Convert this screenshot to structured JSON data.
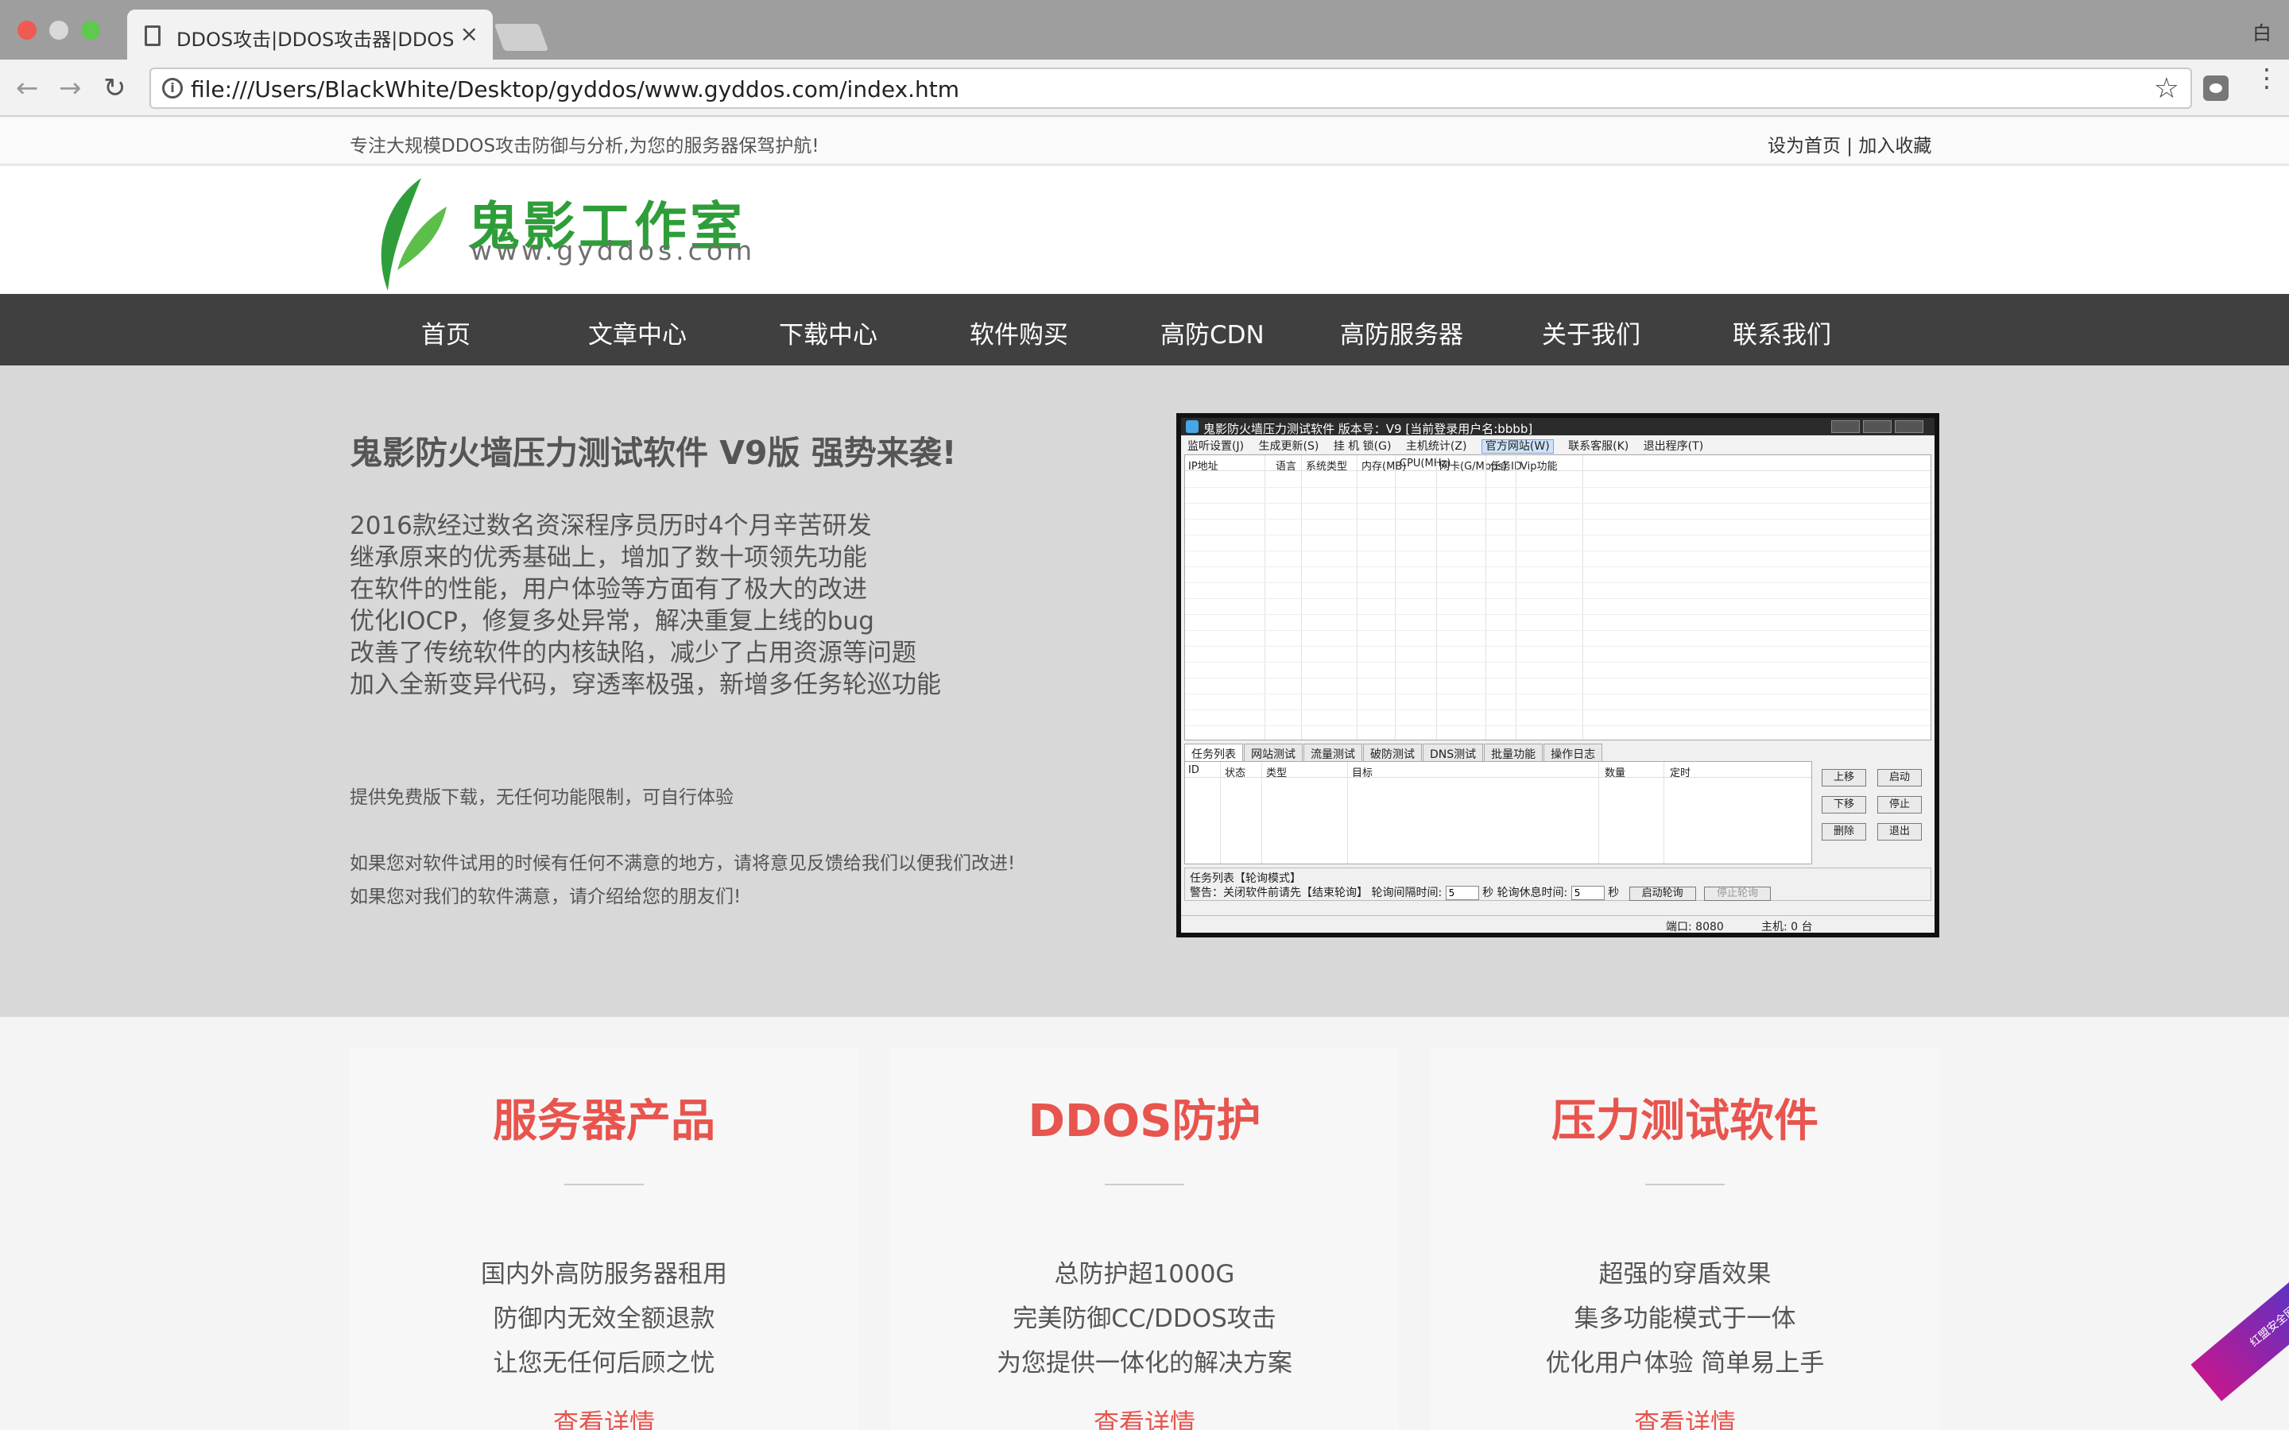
{
  "browser": {
    "tab_title": "DDOS攻击|DDOS攻击器|DDOS",
    "tab_close": "×",
    "url": "file:///Users/BlackWhite/Desktop/gyddos/www.gyddos.com/index.htm",
    "right_glyph": "白",
    "back_icon": "←",
    "forward_icon": "→",
    "reload_icon": "↻",
    "star_icon": "☆",
    "menu_icon": "⋮",
    "info_icon": "i"
  },
  "topbar": {
    "slogan": "专注大规模DDOS攻击防御与分析,为您的服务器保驾护航!",
    "links": "设为首页 | 加入收藏"
  },
  "logo": {
    "title": "鬼影工作室",
    "url": "www.gyddos.com",
    "color": "#2f9e3a"
  },
  "nav": [
    "首页",
    "文章中心",
    "下载中心",
    "软件购买",
    "高防CDN",
    "高防服务器",
    "关于我们",
    "联系我们"
  ],
  "hero": {
    "title": "鬼影防火墙压力测试软件 V9版 强势来袭!",
    "desc": [
      "2016款经过数名资深程序员历时4个月辛苦研发",
      "继承原来的优秀基础上，增加了数十项领先功能",
      "在软件的性能，用户体验等方面有了极大的改进",
      "优化IOCP，修复多处异常，解决重复上线的bug",
      "改善了传统软件的内核缺陷，减少了占用资源等问题",
      "加入全新变异代码，穿透率极强，新增多任务轮巡功能"
    ],
    "free": "提供免费版下载，无任何功能限制，可自行体验",
    "feedback": [
      "如果您对软件试用的时候有任何不满意的地方，请将意见反馈给我们以便我们改进!",
      "如果您对我们的软件满意，请介绍给您的朋友们!"
    ]
  },
  "app": {
    "title": "鬼影防火墙压力测试软件 版本号：V9  [当前登录用户名:bbbb]",
    "menu": [
      "监听设置(J)",
      "生成更新(S)",
      "挂 机 锁(G)",
      "主机统计(Z)",
      "官方网站(W)",
      "联系客服(K)",
      "退出程序(T)"
    ],
    "columns": [
      "IP地址",
      "语言",
      "系统类型",
      "内存(MB)",
      "CPU(MHz)",
      "网卡(G/Mbps)",
      "任务ID",
      "Vip功能"
    ],
    "tabs": [
      "任务列表",
      "网站测试",
      "流量测试",
      "破防测试",
      "DNS测试",
      "批量功能",
      "操作日志"
    ],
    "task_columns": [
      "ID",
      "状态",
      "类型",
      "目标",
      "数量",
      "定时"
    ],
    "buttons": [
      "上移",
      "启动",
      "下移",
      "停止",
      "删除",
      "退出"
    ],
    "loop_label": "任务列表【轮询模式】",
    "warning": "警告：关闭软件前请先【结束轮询】",
    "interval_label": "轮询间隔时间:",
    "interval_value": "5",
    "sec": "秒",
    "rest_label": "轮询休息时间:",
    "rest_value": "5",
    "start_loop": "启动轮询",
    "stop_loop": "停止轮询",
    "port": "端口: 8080",
    "hosts": "主机: 0 台"
  },
  "cards": [
    {
      "title": "服务器产品",
      "lines": [
        "国内外高防服务器租用",
        "防御内无效全额退款",
        "让您无任何后顾之忧"
      ],
      "more": "查看详情"
    },
    {
      "title": "DDOS防护",
      "lines": [
        "总防护超1000G",
        "完美防御CC/DDOS攻击",
        "为您提供一体化的解决方案"
      ],
      "more": "查看详情"
    },
    {
      "title": "压力测试软件",
      "lines": [
        "超强的穿盾效果",
        "集多功能模式于一体",
        "优化用户体验 简单易上手"
      ],
      "more": "查看详情"
    }
  ],
  "accent_color": "#e8544e",
  "nav_bg": "#404040",
  "corner_badge": "红盟安全网"
}
